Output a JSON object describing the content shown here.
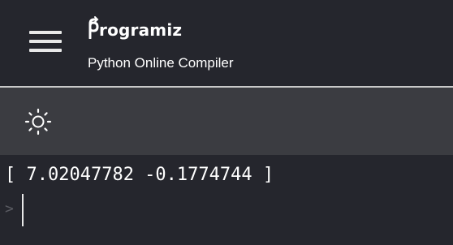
{
  "header": {
    "logo_text": "rogramiz",
    "subtitle": "Python Online Compiler",
    "menu_icon": "hamburger-menu-icon",
    "logo_icon": "programiz-p-logo-icon"
  },
  "toolbar": {
    "theme_icon": "sun-icon"
  },
  "console": {
    "output_line": "[ 7.02047782 -0.1774744 ]",
    "prompt_symbol": ">"
  },
  "colors": {
    "header_bg": "#25262d",
    "toolbar_bg": "#3b3c41",
    "console_bg": "#25262d",
    "text": "#ffffff"
  }
}
